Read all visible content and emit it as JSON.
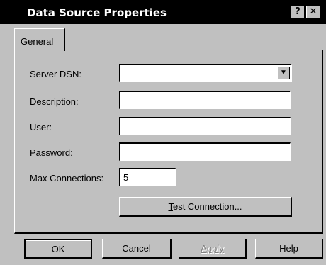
{
  "window": {
    "title": "Data Source Properties",
    "help_icon": "?",
    "close_icon": "✕"
  },
  "tabs": [
    {
      "label": "General",
      "active": true
    }
  ],
  "form": {
    "server_dsn": {
      "label": "Server DSN:",
      "value": ""
    },
    "description": {
      "label": "Description:",
      "value": ""
    },
    "user": {
      "label": "User:",
      "value": ""
    },
    "password": {
      "label": "Password:",
      "value": ""
    },
    "max_connections": {
      "label": "Max Connections:",
      "value": "5"
    },
    "test_connection": {
      "underlined": "T",
      "rest": "est Connection..."
    }
  },
  "buttons": {
    "ok": "OK",
    "cancel": "Cancel",
    "apply": "Apply",
    "help": "Help"
  }
}
